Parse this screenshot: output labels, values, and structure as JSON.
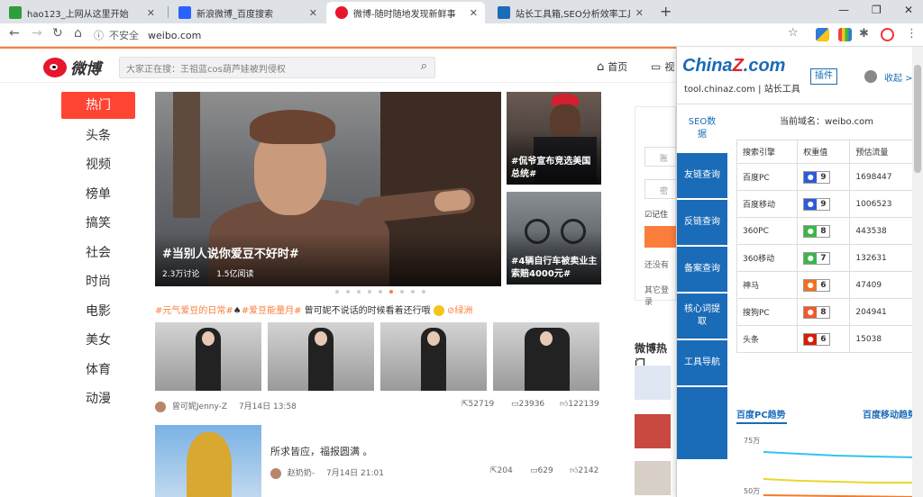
{
  "browser": {
    "tabs": [
      {
        "title": "hao123_上网从这里开始",
        "fav": "#2e9d3b"
      },
      {
        "title": "新浪微博_百度搜索",
        "fav": "#2962ff"
      },
      {
        "title": "微博-随时随地发现新鲜事",
        "fav": "#e6162d"
      },
      {
        "title": "站长工具箱,SEO分析效率工具 - ",
        "fav": "#1a6bb8"
      }
    ],
    "new_tab": "+",
    "url_security": "不安全",
    "url": "weibo.com"
  },
  "weibo": {
    "logo_text": "微博",
    "search_placeholder": "大家正在搜：王祖蓝cos葫芦娃被判侵权",
    "nav_home": "首页",
    "nav_video": "视",
    "left_nav": [
      "热门",
      "头条",
      "视频",
      "榜单",
      "搞笑",
      "社会",
      "时尚",
      "电影",
      "美女",
      "体育",
      "动漫"
    ],
    "hero": {
      "title": "#当别人说你爱豆不好时#",
      "discuss": "2.3万讨论",
      "reads": "1.5亿阅读"
    },
    "side1_title": "#侃爷宣布竞选美国总统#",
    "side2_title": "#4辆自行车被卖业主索赔4000元#",
    "tagline": {
      "tag1": "#元气爱豆的日常#",
      "mid": "♠",
      "tag2": "#爱豆能量月#",
      "text": " 曾可妮不说话的时候看着还行哦 ",
      "loc": "⊘绿洲"
    },
    "post1": {
      "user": "曾可妮Jenny-Z",
      "time": "7月14日 13:58",
      "reposts": "52719",
      "comments": "23936",
      "likes": "122139"
    },
    "post2": {
      "text": "所求皆应，福报圆满 。",
      "user": "赵奶奶-",
      "time": "7月14日 21:01",
      "reposts": "204",
      "comments": "629",
      "likes": "2142"
    },
    "login_hints": [
      "账",
      "密",
      "记住",
      "还没有",
      "其它登录"
    ],
    "hot_title": "微博热门"
  },
  "chinaz": {
    "logo_main": "China",
    "logo_z": "Z",
    "logo_com": ".com",
    "sub": "tool.chinaz.com | 站长工具",
    "plugin_btn": "插件",
    "collapse": "收起 >",
    "menu": [
      "SEO数据",
      "友链查询",
      "反链查询",
      "备案查询",
      "核心词提取",
      "工具导航"
    ],
    "domain_label": "当前域名：weibo.com",
    "table_headers": [
      "搜索引擎",
      "权重值",
      "预估流量"
    ],
    "rows": [
      {
        "engine": "百度PC",
        "icon": "paw",
        "icon_color": "#2e5bd8",
        "weight": "9",
        "traffic": "1698447"
      },
      {
        "engine": "百度移动",
        "icon": "paw",
        "icon_color": "#2e5bd8",
        "weight": "9",
        "traffic": "1006523"
      },
      {
        "engine": "360PC",
        "icon": "360",
        "icon_color": "#3cb64a",
        "weight": "8",
        "traffic": "443538"
      },
      {
        "engine": "360移动",
        "icon": "360",
        "icon_color": "#3cb64a",
        "weight": "7",
        "traffic": "132631"
      },
      {
        "engine": "神马",
        "icon": "sm",
        "icon_color": "#f37021",
        "weight": "6",
        "traffic": "47409"
      },
      {
        "engine": "搜狗PC",
        "icon": "S",
        "icon_color": "#f05a28",
        "weight": "8",
        "traffic": "204941"
      },
      {
        "engine": "头条",
        "icon": "tt",
        "icon_color": "#d81e06",
        "weight": "6",
        "traffic": "15038"
      }
    ],
    "trend_left": "百度PC趋势",
    "trend_right": "百度移动趋势",
    "trend_axis": [
      "75万",
      "50万"
    ],
    "trend_colors": [
      "#31c5e8",
      "#e8d72e",
      "#f07c2c"
    ]
  }
}
